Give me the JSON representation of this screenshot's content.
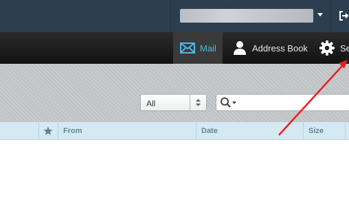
{
  "topbar": {
    "logout_icon": "logout-icon"
  },
  "nav": {
    "items": [
      {
        "label": "Mail",
        "icon": "mail-icon",
        "active": true
      },
      {
        "label": "Address Book",
        "icon": "person-icon",
        "active": false
      },
      {
        "label": "Se",
        "icon": "gear-icon",
        "active": false
      }
    ]
  },
  "toolbar": {
    "filter_value": "All",
    "search_value": ""
  },
  "list": {
    "columns": [
      "",
      "",
      "From",
      "Date",
      "Size"
    ],
    "flag_column_icon": "star-icon"
  },
  "annotation": {
    "type": "arrow",
    "color": "#ee1c1c"
  },
  "colors": {
    "accent": "#4fb8e6",
    "topbar": "#2c3e50",
    "header": "#d5e9f3"
  }
}
